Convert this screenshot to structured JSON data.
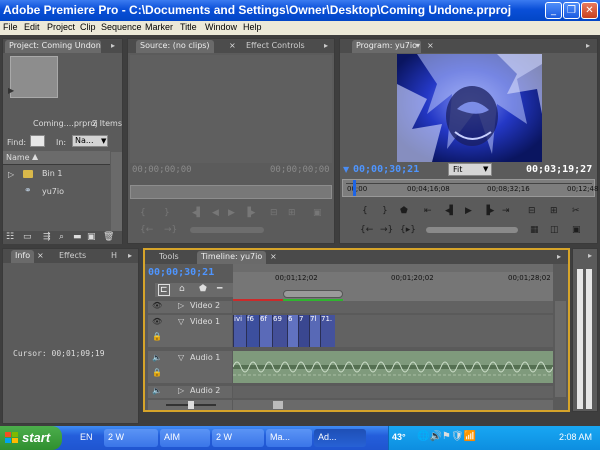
{
  "window": {
    "title": "Adobe Premiere Pro - C:\\Documents and Settings\\Owner\\Desktop\\Coming Undone.prproj"
  },
  "menu": [
    "File",
    "Edit",
    "Project",
    "Clip",
    "Sequence",
    "Marker",
    "Title",
    "Window",
    "Help"
  ],
  "project": {
    "tab": "Project: Coming Undone",
    "name_short": "Coming....prproj",
    "item_count": "2 Items",
    "find_label": "Find:",
    "in_label": "In:",
    "in_value": "Na...",
    "column_name": "Name",
    "items": [
      {
        "label": "Bin 1",
        "icon": "folder-icon"
      },
      {
        "label": "yu7io",
        "icon": "sequence-icon"
      }
    ]
  },
  "source": {
    "tab": "Source: (no clips)",
    "tab2": "Effect Controls",
    "timecode": "00;00;00;00",
    "duration": "00;00;00;00"
  },
  "program": {
    "tab": "Program: yu7io",
    "timecode": "00;00;30;21",
    "zoom": "Fit",
    "duration": "00;03;19;27",
    "ruler_ticks": [
      "00;00",
      "00;04;16;08",
      "00;08;32;16",
      "00;12;48"
    ]
  },
  "info": {
    "tabs": [
      "Info",
      "Effects",
      "H"
    ],
    "cursor_label": "Cursor: 00;01;09;19"
  },
  "timeline": {
    "tabs": [
      "Tools",
      "Timeline: yu7io"
    ],
    "timecode": "00;00;30;21",
    "ruler_ticks": [
      "00;01;12;02",
      "00;01;20;02",
      "00;01;28;02"
    ],
    "tracks": [
      {
        "label": "Video 2",
        "kind": "video"
      },
      {
        "label": "Video 1",
        "kind": "video"
      },
      {
        "label": "Audio 1",
        "kind": "audio"
      },
      {
        "label": "Audio 2",
        "kind": "audio"
      }
    ],
    "clip_labels": [
      "ivi",
      "f6",
      "6f",
      "69",
      "6",
      "7",
      "7l",
      "71."
    ]
  },
  "taskbar": {
    "start": "start",
    "lang": "EN",
    "tasks": [
      "2 W",
      "AIM",
      "2 W",
      "Ma...",
      "Ad..."
    ],
    "temperature": "43°",
    "clock": "2:08 AM"
  }
}
